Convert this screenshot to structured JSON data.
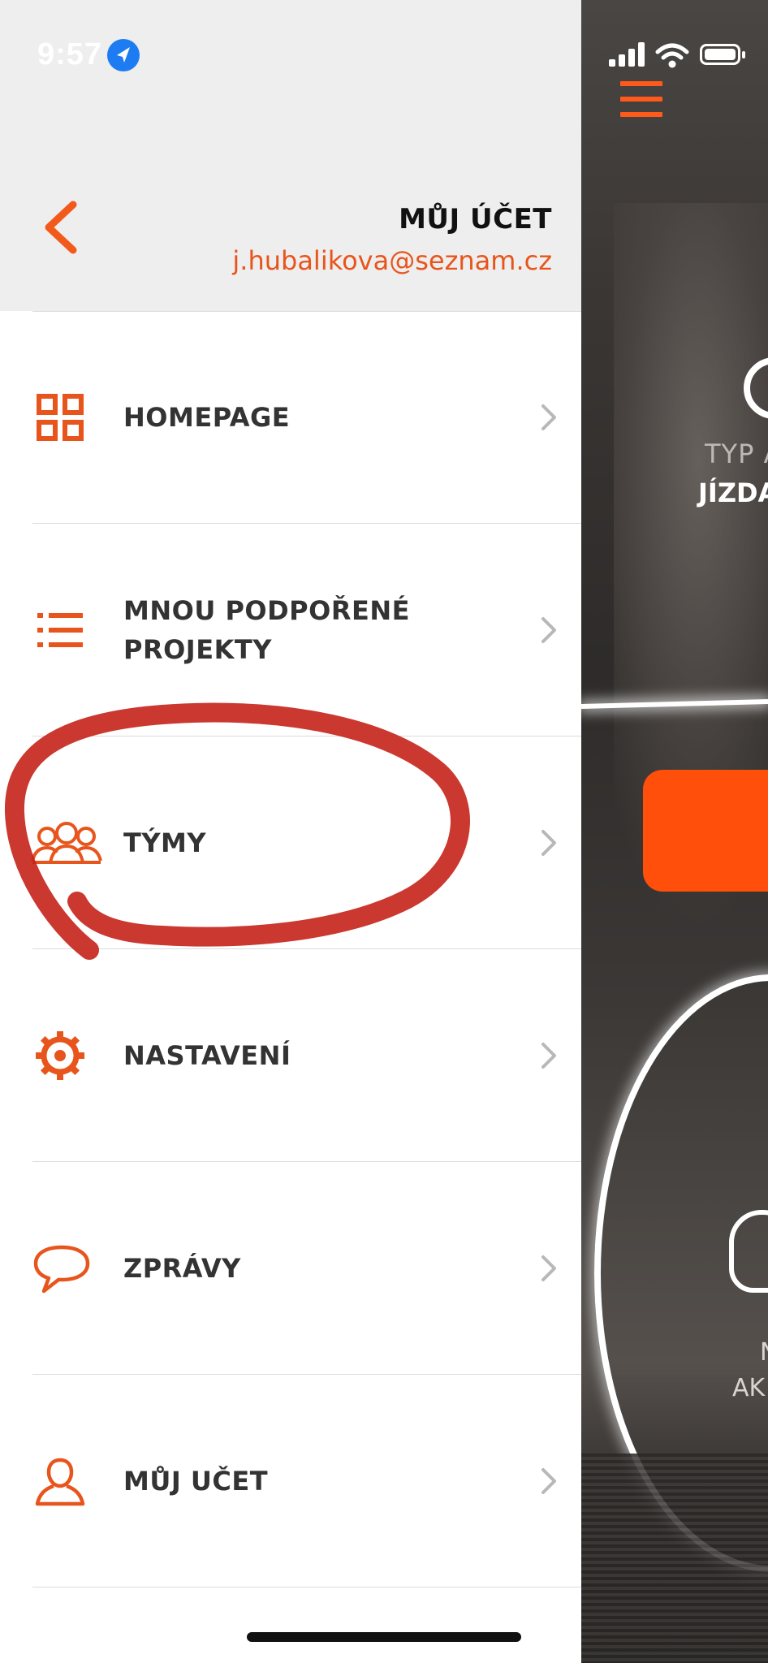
{
  "status_bar": {
    "time": "9:57"
  },
  "drawer": {
    "header": {
      "title": "MŮJ ÚČET",
      "email": "j.hubalikova@seznam.cz"
    },
    "menu": [
      {
        "label": "HOMEPAGE",
        "icon": "grid-icon"
      },
      {
        "label": "MNOU PODPOŘENÉ PROJEKTY",
        "icon": "list-icon"
      },
      {
        "label": "TÝMY",
        "icon": "team-icon"
      },
      {
        "label": "NASTAVENÍ",
        "icon": "gear-icon"
      },
      {
        "label": "ZPRÁVY",
        "icon": "chat-bubble-icon"
      },
      {
        "label": "MŮJ UČET",
        "icon": "user-icon"
      }
    ]
  },
  "background_app": {
    "typ_label": "TYP A",
    "jizda_label": "JÍZDA",
    "n_label": "N",
    "ak_label": "AK"
  },
  "colors": {
    "accent": "#e8551c",
    "header_bg": "#eeeeee",
    "annotation": "#c4221a"
  }
}
